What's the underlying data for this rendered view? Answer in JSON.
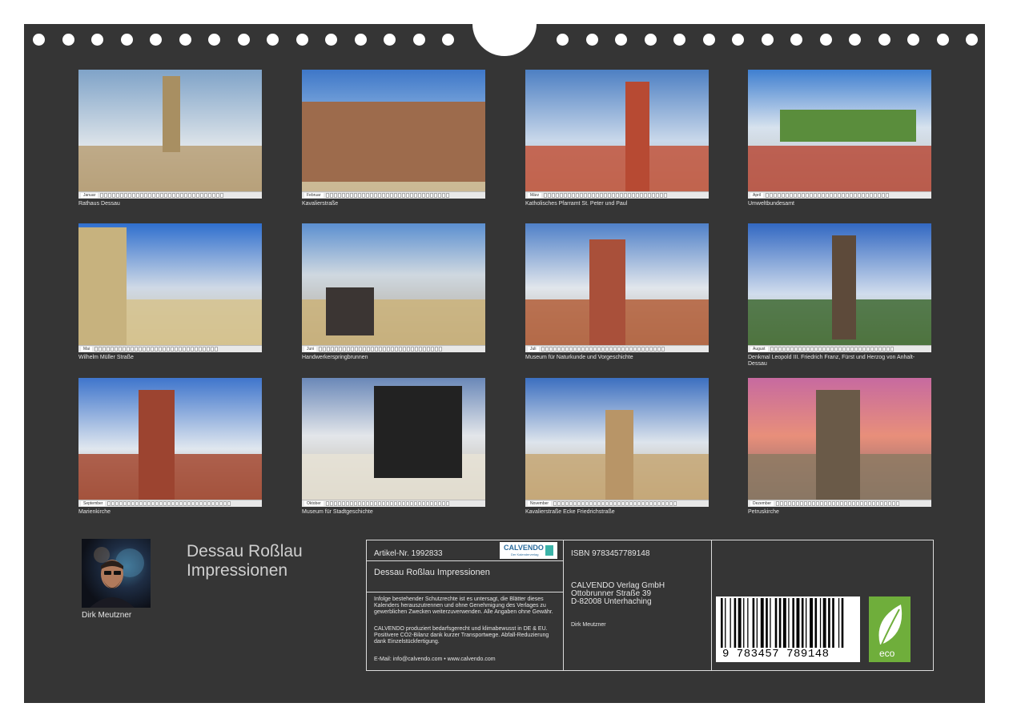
{
  "photos": [
    {
      "caption": "Rathaus Dessau",
      "month": "Januar"
    },
    {
      "caption": "Kavalierstraße",
      "month": "Februar"
    },
    {
      "caption": "Katholisches Pfarramt St. Peter und Paul",
      "month": "März"
    },
    {
      "caption": "Umweltbundesamt",
      "month": "April"
    },
    {
      "caption": "Wilhelm Müller Straße",
      "month": "Mai"
    },
    {
      "caption": "Handwerkerspringbrunnen",
      "month": "Juni"
    },
    {
      "caption": "Museum für Naturkunde und Vorgeschichte",
      "month": "Juli"
    },
    {
      "caption": "Denkmal Leopold III. Friedrich Franz, Fürst und Herzog von Anhalt-Dessau",
      "month": "August"
    },
    {
      "caption": "Marienkirche",
      "month": "September"
    },
    {
      "caption": "Museum für Stadtgeschichte",
      "month": "Oktober"
    },
    {
      "caption": "Kavalierstraße Ecke Friedrichstraße",
      "month": "November"
    },
    {
      "caption": "Petruskirche",
      "month": "Dezember"
    }
  ],
  "author": {
    "name": "Dirk Meutzner"
  },
  "title": {
    "line1": "Dessau Roßlau",
    "line2": "Impressionen"
  },
  "info": {
    "article": "Artikel-Nr. 1992833",
    "logo_text": "CALVENDO",
    "logo_sub": "Der Kalenderverlag",
    "calendar_title": "Dessau Roßlau Impressionen",
    "legal_1": "Infolge bestehender Schutzrechte ist es untersagt, die Blätter dieses Kalenders herauszutrennen und ohne Genehmigung des Verlages zu gewerblichen Zwecken weiterzuverwenden. Alle Angaben ohne Gewähr.",
    "legal_2": "CALVENDO produziert bedarfsgerecht und klimabewusst in DE & EU. Positivere CO2-Bilanz dank kurzer Transportwege. Abfall-Reduzierung dank Einzelstückfertigung.",
    "contact": "E-Mail: info@calvendo.com • www.calvendo.com",
    "isbn": "ISBN 9783457789148",
    "publisher_1": "CALVENDO Verlag GmbH",
    "publisher_2": "Ottobrunner Straße 39",
    "publisher_3": "D-82008 Unterhaching",
    "author_small": "Dirk Meutzner",
    "barcode_digits": "9 783457 789148",
    "eco_label": "eco"
  },
  "colors": {
    "background": "#353535",
    "frame": "#dcdcdc",
    "eco": "#6fae3b"
  }
}
